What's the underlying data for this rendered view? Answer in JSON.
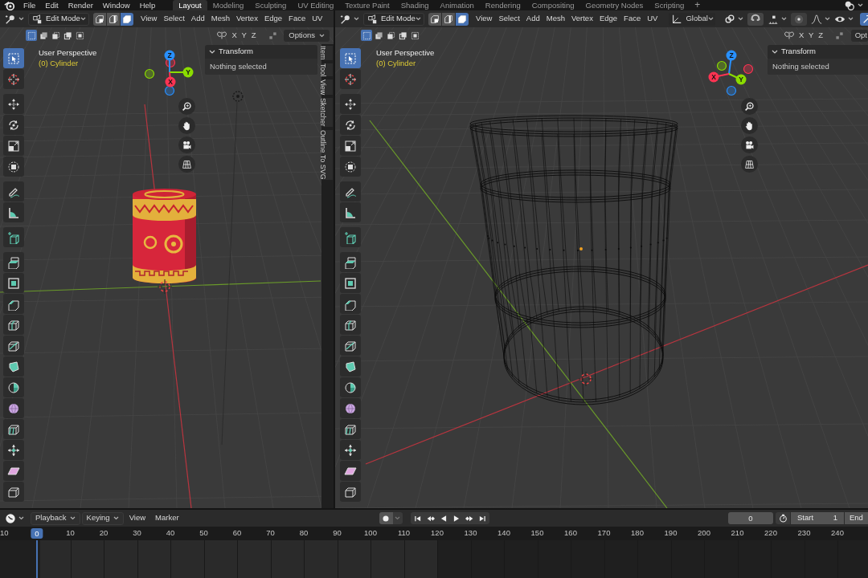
{
  "top_bar": {
    "menus": [
      "File",
      "Edit",
      "Render",
      "Window",
      "Help"
    ],
    "workspaces": [
      {
        "label": "Layout",
        "selected": true
      },
      {
        "label": "Modeling",
        "selected": false
      },
      {
        "label": "Sculpting",
        "selected": false
      },
      {
        "label": "UV Editing",
        "selected": false
      },
      {
        "label": "Texture Paint",
        "selected": false
      },
      {
        "label": "Shading",
        "selected": false
      },
      {
        "label": "Animation",
        "selected": false
      },
      {
        "label": "Rendering",
        "selected": false
      },
      {
        "label": "Compositing",
        "selected": false
      },
      {
        "label": "Geometry Nodes",
        "selected": false
      },
      {
        "label": "Scripting",
        "selected": false
      }
    ],
    "add_workspace": "+"
  },
  "viewports": [
    {
      "kind": "textured",
      "header": {
        "mode": "Edit Mode",
        "select_modes": [
          {
            "selected": false
          },
          {
            "selected": false
          },
          {
            "selected": true
          }
        ],
        "menus": [
          "View",
          "Select",
          "Add",
          "Mesh",
          "Vertex",
          "Edge",
          "Face",
          "UV"
        ]
      },
      "tool_header": {
        "box_modes": [
          {
            "selected": true
          },
          {
            "selected": false
          },
          {
            "selected": false
          },
          {
            "selected": false
          },
          {
            "selected": false
          }
        ],
        "mirror_axes": [
          "X",
          "Y",
          "Z"
        ],
        "options": "Options"
      },
      "overlay": {
        "view": "User Perspective",
        "object": "(0) Cylinder"
      },
      "gizmo": {
        "x": "X",
        "y": "Y",
        "z": "Z"
      },
      "tool_groups": [
        [
          {
            "selected": true
          },
          {
            "selected": false
          }
        ],
        [
          {
            "selected": false
          },
          {
            "selected": false
          },
          {
            "selected": false
          },
          {
            "selected": false
          }
        ],
        [
          {
            "selected": false
          },
          {
            "selected": false
          }
        ],
        [
          {
            "selected": false
          }
        ],
        [
          {
            "selected": false
          },
          {
            "selected": false
          },
          {
            "selected": false
          },
          {
            "selected": false
          },
          {
            "selected": false
          },
          {
            "selected": false
          },
          {
            "selected": false
          },
          {
            "selected": false
          },
          {
            "selected": false
          },
          {
            "selected": false
          },
          {
            "selected": false
          },
          {
            "selected": false
          }
        ]
      ],
      "sidebar": {
        "panel": "Transform",
        "message": "Nothing selected",
        "tabs": [
          "Item",
          "Tool",
          "View",
          "Sketcher",
          "Outline To SVG"
        ]
      }
    },
    {
      "kind": "wireframe",
      "header": {
        "mode": "Edit Mode",
        "select_modes": [
          {
            "selected": false
          },
          {
            "selected": false
          },
          {
            "selected": true
          }
        ],
        "menus": [
          "View",
          "Select",
          "Add",
          "Mesh",
          "Vertex",
          "Edge",
          "Face",
          "UV"
        ],
        "orientation": "Global"
      },
      "tool_header": {
        "box_modes": [
          {
            "selected": true
          },
          {
            "selected": false
          },
          {
            "selected": false
          },
          {
            "selected": false
          },
          {
            "selected": false
          }
        ],
        "mirror_axes": [
          "X",
          "Y",
          "Z"
        ],
        "options": "Opt"
      },
      "overlay": {
        "view": "User Perspective",
        "object": "(0) Cylinder"
      },
      "gizmo": {
        "x": "X",
        "y": "Y",
        "z": "Z"
      },
      "tool_groups": [
        [
          {
            "selected": true
          },
          {
            "selected": false
          }
        ],
        [
          {
            "selected": false
          },
          {
            "selected": false
          },
          {
            "selected": false
          },
          {
            "selected": false
          }
        ],
        [
          {
            "selected": false
          },
          {
            "selected": false
          }
        ],
        [
          {
            "selected": false
          }
        ],
        [
          {
            "selected": false
          },
          {
            "selected": false
          },
          {
            "selected": false
          },
          {
            "selected": false
          },
          {
            "selected": false
          },
          {
            "selected": false
          },
          {
            "selected": false
          },
          {
            "selected": false
          },
          {
            "selected": false
          },
          {
            "selected": false
          },
          {
            "selected": false
          },
          {
            "selected": false
          }
        ]
      ],
      "sidebar": {
        "panel": "Transform",
        "message": "Nothing selected"
      }
    }
  ],
  "timeline": {
    "menus": [
      "Playback",
      "Keying",
      "View",
      "Marker"
    ],
    "frame": "0",
    "start_label": "Start",
    "start": "1",
    "end_label": "End",
    "playhead": "0",
    "ruler": [
      "10",
      "10",
      "20",
      "30",
      "40",
      "50",
      "60",
      "70",
      "80",
      "90",
      "100",
      "110",
      "120",
      "130",
      "140",
      "150",
      "160",
      "170",
      "180",
      "190",
      "200",
      "210",
      "220",
      "230",
      "240"
    ]
  }
}
